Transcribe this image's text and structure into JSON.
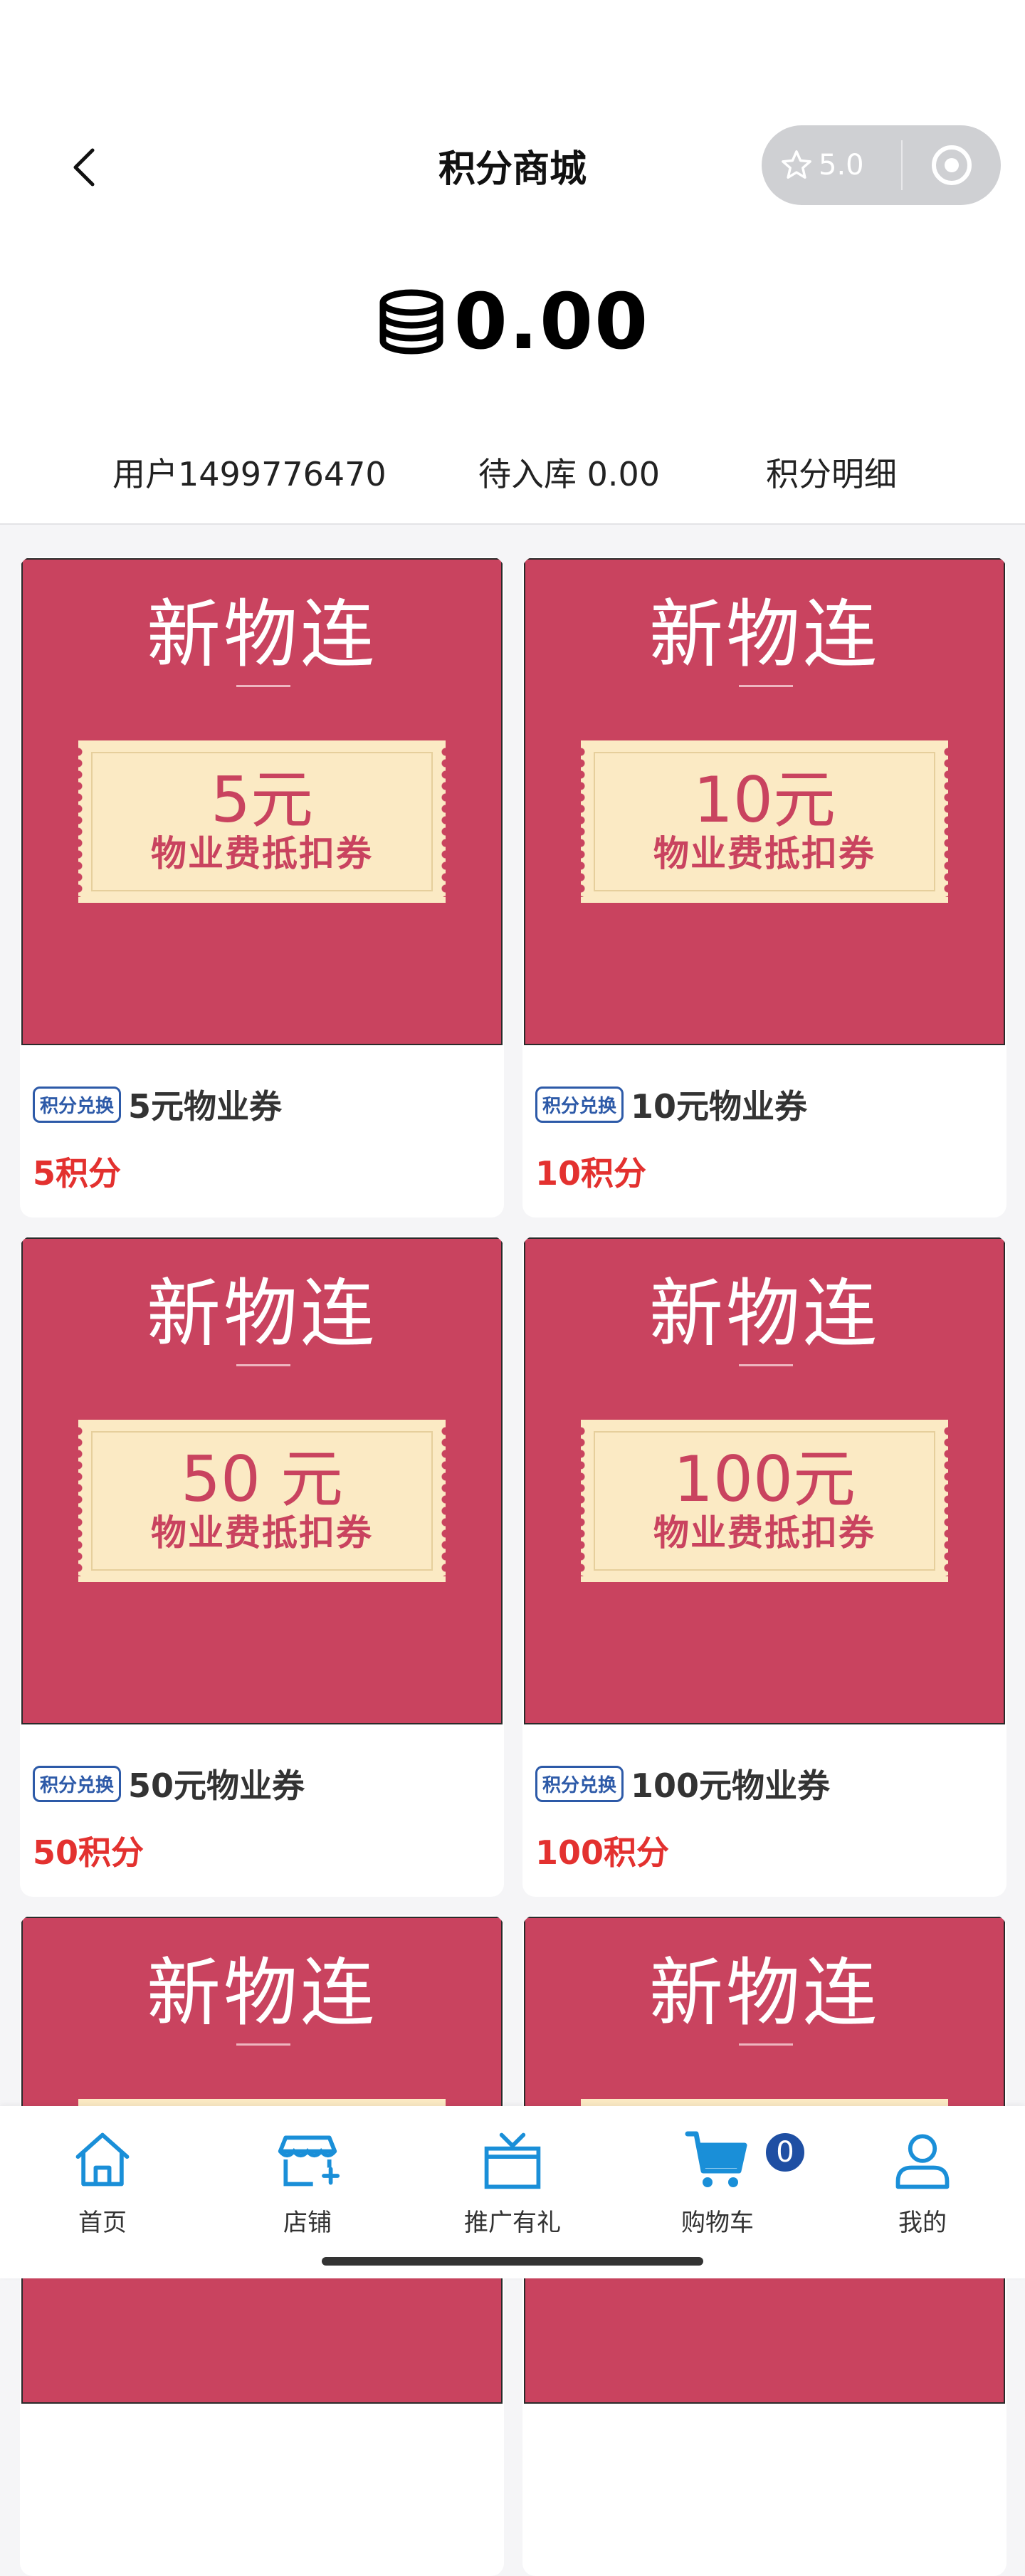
{
  "header": {
    "title": "积分商城",
    "rating": "5.0",
    "balance": "0.00"
  },
  "stats": {
    "user": "用户1499776470",
    "pending": "待入库 0.00",
    "detail_link": "积分明细"
  },
  "products": [
    {
      "brand": "新物连",
      "ticket_amount": "5元",
      "ticket_label": "物业费抵扣券",
      "tag": "积分兑换",
      "name": "5元物业券",
      "price": "5积分"
    },
    {
      "brand": "新物连",
      "ticket_amount": "10元",
      "ticket_label": "物业费抵扣券",
      "tag": "积分兑换",
      "name": "10元物业券",
      "price": "10积分"
    },
    {
      "brand": "新物连",
      "ticket_amount": "50 元",
      "ticket_label": "物业费抵扣券",
      "tag": "积分兑换",
      "name": "50元物业券",
      "price": "50积分"
    },
    {
      "brand": "新物连",
      "ticket_amount": "100元",
      "ticket_label": "物业费抵扣券",
      "tag": "积分兑换",
      "name": "100元物业券",
      "price": "100积分"
    },
    {
      "brand": "新物连"
    },
    {
      "brand": "新物连"
    }
  ],
  "tabbar": {
    "items": [
      {
        "label": "首页",
        "icon": "home-icon"
      },
      {
        "label": "店铺",
        "icon": "store-icon"
      },
      {
        "label": "推广有礼",
        "icon": "gift-icon"
      },
      {
        "label": "购物车",
        "icon": "cart-icon"
      },
      {
        "label": "我的",
        "icon": "user-icon"
      }
    ],
    "cart_count": "0"
  },
  "colors": {
    "accent": "#1a8fd8",
    "card_red": "#c9435f",
    "price_red": "#e3312f",
    "tag_blue": "#2d5aa8"
  }
}
